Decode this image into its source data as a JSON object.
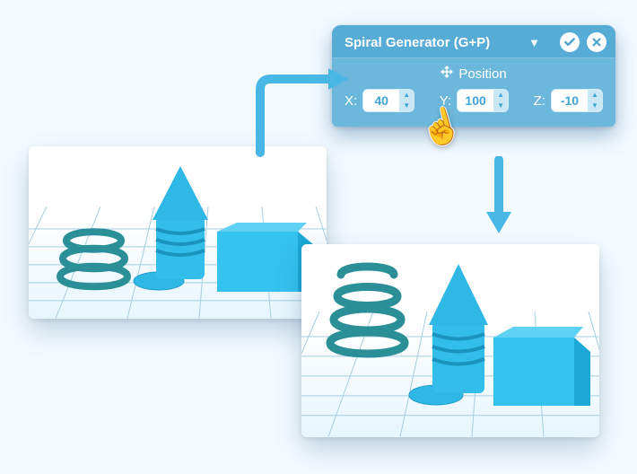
{
  "panel": {
    "title": "Spiral Generator (G+P)",
    "section": "Position",
    "x_label": "X:",
    "y_label": "Y:",
    "z_label": "Z:",
    "x_value": "40",
    "y_value": "100",
    "z_value": "-10"
  },
  "viewports": {
    "before": {
      "name": "before-viewport"
    },
    "after": {
      "name": "after-viewport"
    }
  }
}
